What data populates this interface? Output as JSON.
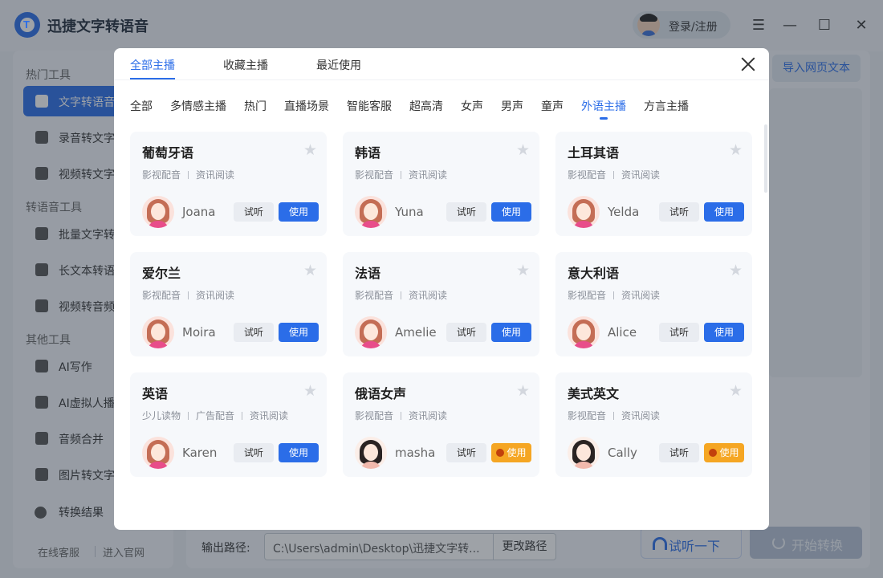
{
  "app": {
    "name": "迅捷文字转语音",
    "login_label": "登录/注册"
  },
  "window": {
    "menu_icon": "☰",
    "minimize_icon": "—",
    "maximize_icon": "☐",
    "close_icon": "✕"
  },
  "sidebar": {
    "groups": [
      "热门工具",
      "转语音工具",
      "其他工具"
    ],
    "items": [
      {
        "label": "文字转语音",
        "icon": "text-to-speech-icon",
        "active": true
      },
      {
        "label": "录音转文字",
        "icon": "recording-icon",
        "active": false
      },
      {
        "label": "视频转文字",
        "icon": "video-text-icon",
        "active": false
      },
      {
        "label": "批量文字转",
        "icon": "batch-icon",
        "active": false
      },
      {
        "label": "长文本转语",
        "icon": "long-text-icon",
        "active": false
      },
      {
        "label": "视频转音频",
        "icon": "video-audio-icon",
        "active": false
      },
      {
        "label": "AI写作",
        "icon": "ai-write-icon",
        "active": false
      },
      {
        "label": "AI虚拟人播",
        "icon": "ai-avatar-icon",
        "active": false
      },
      {
        "label": "音频合并",
        "icon": "audio-merge-icon",
        "active": false
      },
      {
        "label": "图片转文字",
        "icon": "image-text-icon",
        "active": false
      }
    ],
    "result_label": "转换结果",
    "footer": {
      "service": "在线客服",
      "website": "进入官网"
    }
  },
  "main": {
    "import_label": "导入网页文本",
    "output_label": "输出路径:",
    "output_path": "C:\\Users\\admin\\Desktop\\迅捷文字转...",
    "change_path_label": "更改路径",
    "listen_label": "试听一下",
    "start_label": "开始转换"
  },
  "modal": {
    "tabs": [
      {
        "label": "全部主播",
        "active": true
      },
      {
        "label": "收藏主播",
        "active": false
      },
      {
        "label": "最近使用",
        "active": false
      }
    ],
    "close_icon": "close-icon",
    "categories": [
      {
        "label": "全部",
        "active": false
      },
      {
        "label": "多情感主播",
        "active": false
      },
      {
        "label": "热门",
        "active": false
      },
      {
        "label": "直播场景",
        "active": false
      },
      {
        "label": "智能客服",
        "active": false
      },
      {
        "label": "超高清",
        "active": false
      },
      {
        "label": "女声",
        "active": false
      },
      {
        "label": "男声",
        "active": false
      },
      {
        "label": "童声",
        "active": false
      },
      {
        "label": "外语主播",
        "active": true
      },
      {
        "label": "方言主播",
        "active": false
      }
    ],
    "voices": [
      {
        "title": "葡萄牙语",
        "tags": [
          "影视配音",
          "资讯阅读"
        ],
        "name": "Joana",
        "try": "试听",
        "use": "使用",
        "vip": false
      },
      {
        "title": "韩语",
        "tags": [
          "影视配音",
          "资讯阅读"
        ],
        "name": "Yuna",
        "try": "试听",
        "use": "使用",
        "vip": false
      },
      {
        "title": "土耳其语",
        "tags": [
          "影视配音",
          "资讯阅读"
        ],
        "name": "Yelda",
        "try": "试听",
        "use": "使用",
        "vip": false
      },
      {
        "title": "爱尔兰",
        "tags": [
          "影视配音",
          "资讯阅读"
        ],
        "name": "Moira",
        "try": "试听",
        "use": "使用",
        "vip": false
      },
      {
        "title": "法语",
        "tags": [
          "影视配音",
          "资讯阅读"
        ],
        "name": "Amelie",
        "try": "试听",
        "use": "使用",
        "vip": false
      },
      {
        "title": "意大利语",
        "tags": [
          "影视配音",
          "资讯阅读"
        ],
        "name": "Alice",
        "try": "试听",
        "use": "使用",
        "vip": false
      },
      {
        "title": "英语",
        "tags": [
          "少儿读物",
          "广告配音",
          "资讯阅读"
        ],
        "name": "Karen",
        "try": "试听",
        "use": "使用",
        "vip": false
      },
      {
        "title": "俄语女声",
        "tags": [
          "影视配音",
          "资讯阅读"
        ],
        "name": "masha",
        "try": "试听",
        "use": "使用",
        "vip": true
      },
      {
        "title": "美式英文",
        "tags": [
          "影视配音",
          "资讯阅读"
        ],
        "name": "Cally",
        "try": "试听",
        "use": "使用",
        "vip": true
      }
    ]
  }
}
